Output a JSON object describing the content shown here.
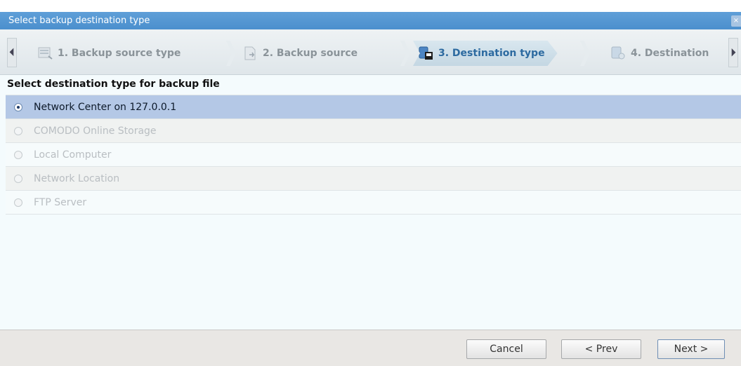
{
  "title_bar": {
    "title": "Select backup destination type",
    "close_glyph": "×"
  },
  "wizard": {
    "scroll_left_glyph": "⏴",
    "scroll_right_glyph": "⏵",
    "steps": [
      {
        "label": "1. Backup source type",
        "icon": "backup-source-type-icon",
        "state": "inactive"
      },
      {
        "label": "2. Backup source",
        "icon": "backup-source-icon",
        "state": "inactive"
      },
      {
        "label": "3. Destination type",
        "icon": "destination-type-icon",
        "state": "active"
      },
      {
        "label": "4. Destination",
        "icon": "destination-icon",
        "state": "inactive"
      }
    ]
  },
  "content": {
    "heading": "Select destination type for backup file",
    "options": [
      {
        "label": "Network Center on 127.0.0.1",
        "selected": true,
        "enabled": true
      },
      {
        "label": "COMODO Online Storage",
        "selected": false,
        "enabled": false
      },
      {
        "label": "Local Computer",
        "selected": false,
        "enabled": false
      },
      {
        "label": "Network Location",
        "selected": false,
        "enabled": false
      },
      {
        "label": "FTP Server",
        "selected": false,
        "enabled": false
      }
    ]
  },
  "footer": {
    "cancel_label": "Cancel",
    "prev_label": "< Prev",
    "next_label": "Next >"
  },
  "colors": {
    "title_bar": "#4b8fcd",
    "active_step_text": "#2c6aa0",
    "selected_row": "#b4c8e6"
  }
}
